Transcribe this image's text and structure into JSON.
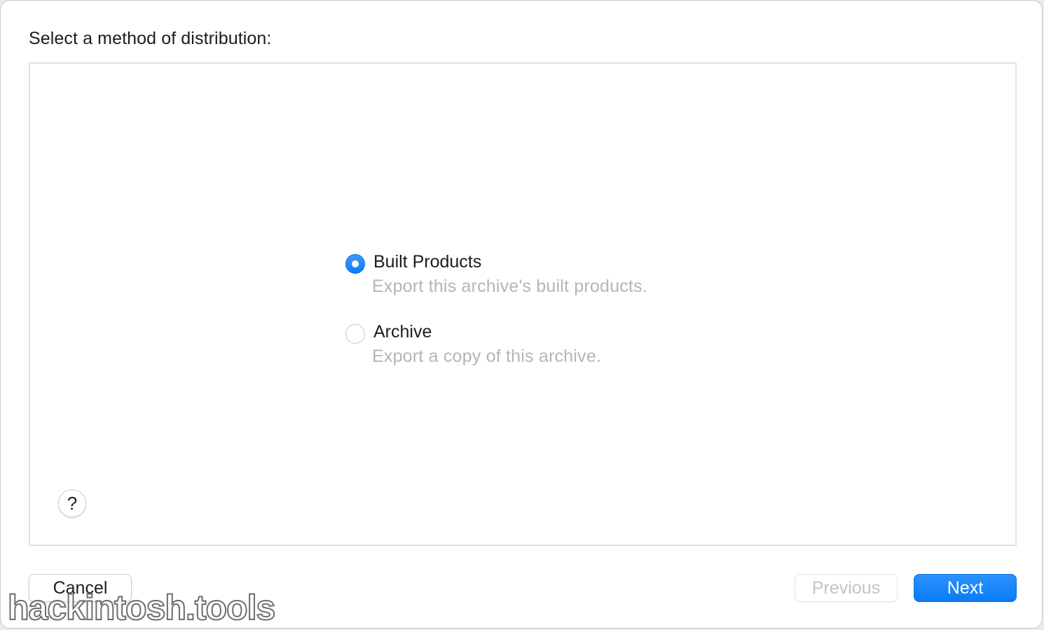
{
  "dialog": {
    "heading": "Select a method of distribution:"
  },
  "options": [
    {
      "title": "Built Products",
      "description": "Export this archive's built products.",
      "selected": true
    },
    {
      "title": "Archive",
      "description": "Export a copy of this archive.",
      "selected": false
    }
  ],
  "help": {
    "label": "?"
  },
  "buttons": {
    "cancel": "Cancel",
    "previous": "Previous",
    "next": "Next"
  },
  "watermark": "hackintosh.tools",
  "colors": {
    "accent": "#0a7cf5",
    "disabled_text": "#c3c3c3",
    "secondary_text": "#b5b5b5"
  }
}
